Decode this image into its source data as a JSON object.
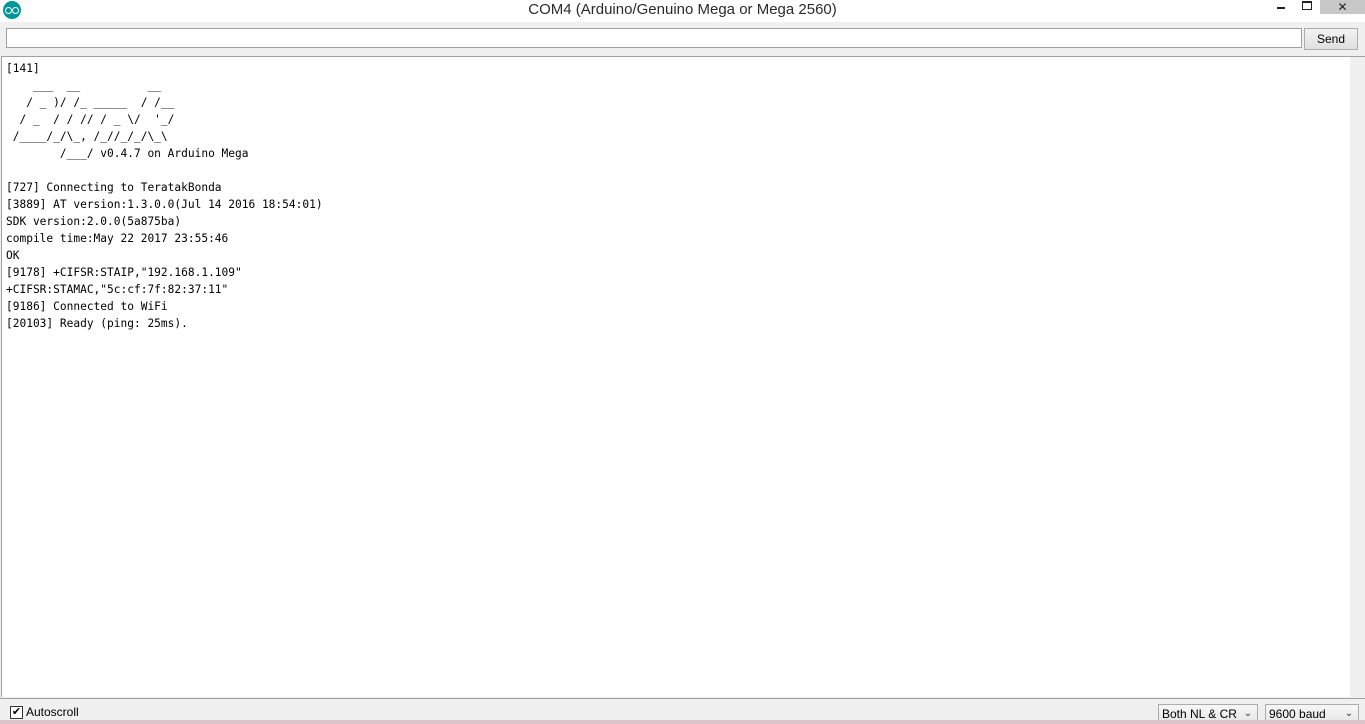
{
  "window": {
    "title": "COM4 (Arduino/Genuino Mega or Mega 2560)",
    "close_symbol": "✕"
  },
  "send_bar": {
    "input_value": "",
    "send_label": "Send"
  },
  "console": {
    "lines": [
      "[141]",
      "    ___  __          __",
      "   / _ )/ /_ _____  / /__",
      "  / _  / / // / _ \\/  '_/",
      " /____/_/\\_, /_//_/_/\\_\\",
      "        /___/ v0.4.7 on Arduino Mega",
      "",
      "[727] Connecting to TeratakBonda",
      "[3889] AT version:1.3.0.0(Jul 14 2016 18:54:01)",
      "SDK version:2.0.0(5a875ba)",
      "compile time:May 22 2017 23:55:46",
      "OK",
      "[9178] +CIFSR:STAIP,\"192.168.1.109\"",
      "+CIFSR:STAMAC,\"5c:cf:7f:82:37:11\"",
      "[9186] Connected to WiFi",
      "[20103] Ready (ping: 25ms)."
    ]
  },
  "status_bar": {
    "autoscroll_label": "Autoscroll",
    "autoscroll_checked": true,
    "line_ending": "Both NL & CR",
    "baud_rate": "9600 baud"
  },
  "icons": {
    "app": "arduino-logo-icon",
    "minimize": "minimize-icon",
    "maximize": "maximize-icon",
    "close": "close-icon",
    "checkbox": "checkmark-icon",
    "dropdown": "chevron-down-icon"
  },
  "colors": {
    "arduino_teal": "#00979c",
    "window_bg": "#f0f0f0",
    "console_bg": "#ffffff"
  }
}
